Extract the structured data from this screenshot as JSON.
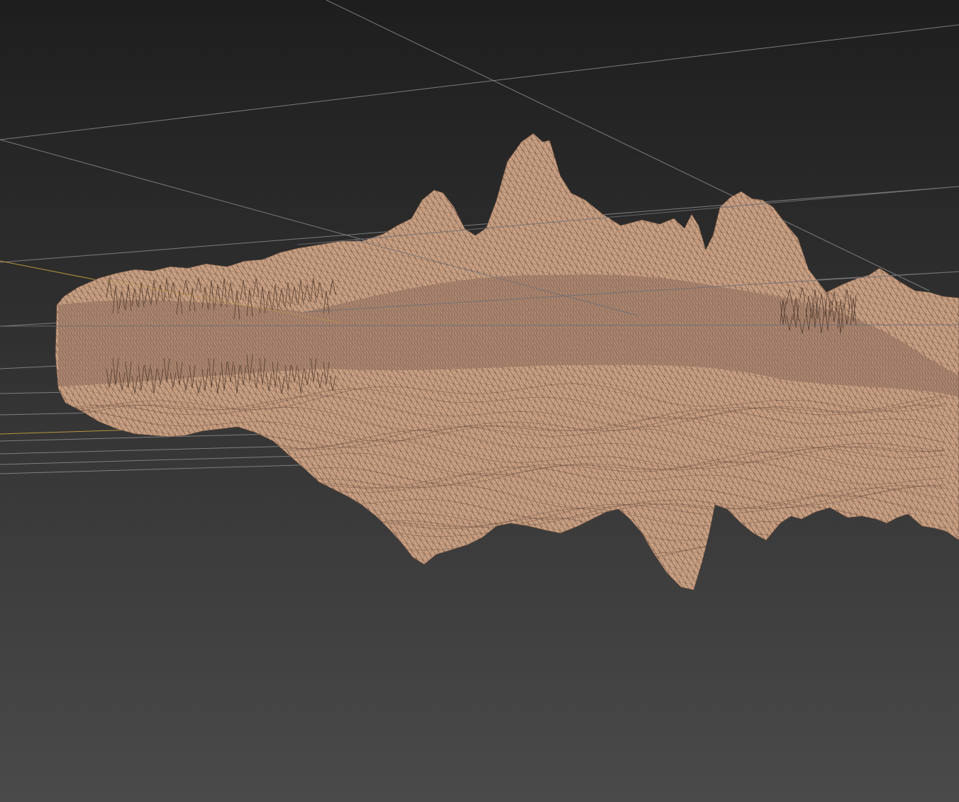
{
  "viewport": {
    "view": "perspective",
    "render_mode": "wireframe-on-shaded",
    "colors": {
      "background_top": "#1e1e1e",
      "background_bottom": "#4a4a4a",
      "mesh_fill": "#c9a083",
      "mesh_fill_shadow": "#a98470",
      "mesh_wire": "#5a4234",
      "grid_line": "#8b8b8b",
      "axis_highlight": "#c8a03c"
    },
    "objects": [
      {
        "name": "terrain-mesh",
        "type": "mesh",
        "selected": false
      }
    ],
    "grid": {
      "visible": true
    }
  }
}
